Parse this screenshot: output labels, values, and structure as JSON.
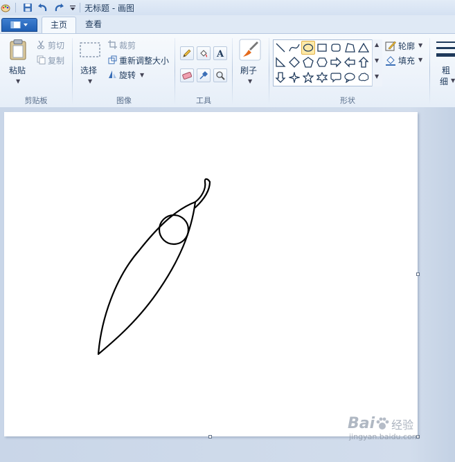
{
  "window": {
    "title": "无标题 - 画图"
  },
  "tabs": [
    {
      "label": "主页"
    },
    {
      "label": "查看"
    }
  ],
  "clipboard": {
    "paste_label": "粘贴",
    "cut_label": "剪切",
    "copy_label": "复制",
    "group_label": "剪贴板"
  },
  "image": {
    "select_label": "选择",
    "crop_label": "裁剪",
    "resize_label": "重新调整大小",
    "rotate_label": "旋转",
    "group_label": "图像"
  },
  "tools": {
    "group_label": "工具",
    "icons": [
      "pencil-icon",
      "fill-icon",
      "text-icon",
      "eraser-icon",
      "color-picker-icon",
      "magnifier-icon"
    ]
  },
  "brushes": {
    "label": "刷子"
  },
  "shapes": {
    "group_label": "形状",
    "outline_label": "轮廓",
    "fill_label": "填充",
    "selected": "oval",
    "items": [
      "line",
      "curve",
      "oval",
      "rectangle",
      "rounded-rectangle",
      "polygon",
      "triangle",
      "right-triangle",
      "diamond",
      "pentagon",
      "hexagon",
      "right-arrow",
      "left-arrow",
      "up-arrow",
      "down-arrow",
      "four-point-star",
      "five-point-star",
      "six-point-star",
      "rounded-callout",
      "oval-callout",
      "cloud-callout"
    ]
  },
  "size": {
    "label_line1": "粗",
    "label_line2": "细"
  },
  "watermark": {
    "brand_left": "Bai",
    "brand_right": "经验",
    "url": "jingyan.baidu.com"
  },
  "colors": {
    "accent": "#1f5fb4",
    "selected_shape": "#fde9a8",
    "canvas": "#ffffff",
    "workspace": "#cdd9ea"
  }
}
